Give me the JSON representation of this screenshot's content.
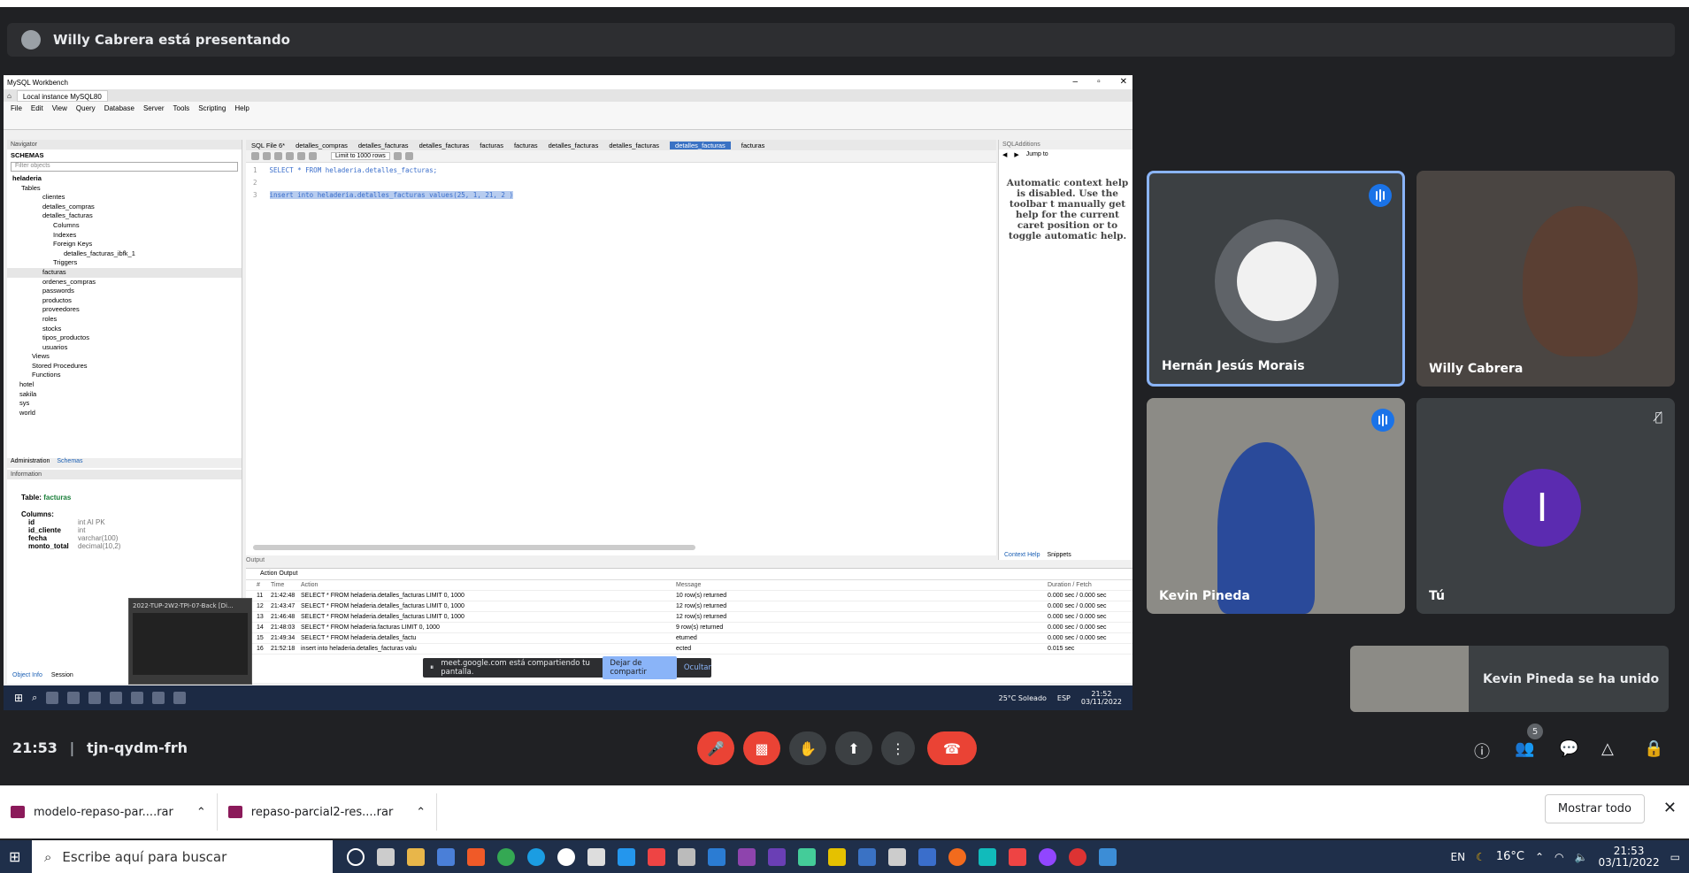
{
  "presenting": {
    "text": "Willy Cabrera está presentando"
  },
  "workbench": {
    "title": "MySQL Workbench",
    "conn_tab": "Local instance MySQL80",
    "menu": [
      "File",
      "Edit",
      "View",
      "Query",
      "Database",
      "Server",
      "Tools",
      "Scripting",
      "Help"
    ],
    "navigator": "Navigator",
    "schemas_header": "SCHEMAS",
    "filter_placeholder": "Filter objects",
    "tree": [
      "heladeria",
      "Tables",
      "clientes",
      "detalles_compras",
      "detalles_facturas",
      "Columns",
      "Indexes",
      "Foreign Keys",
      "detalles_facturas_ibfk_1",
      "Triggers",
      "facturas",
      "ordenes_compras",
      "passwords",
      "productos",
      "proveedores",
      "roles",
      "stocks",
      "tipos_productos",
      "usuarios",
      "Views",
      "Stored Procedures",
      "Functions",
      "hotel",
      "sakila",
      "sys",
      "world"
    ],
    "nav_tabs": [
      "Administration",
      "Schemas"
    ],
    "info_header": "Information",
    "info_table_label": "Table:",
    "info_table": "facturas",
    "info_columns": "Columns:",
    "columns": [
      {
        "name": "id",
        "type": "int AI PK"
      },
      {
        "name": "id_cliente",
        "type": "int"
      },
      {
        "name": "fecha",
        "type": "varchar(100)"
      },
      {
        "name": "monto_total",
        "type": "decimal(10,2)"
      }
    ],
    "bottom_tabs": [
      "Object Info",
      "Session"
    ],
    "editor_tabs": [
      "SQL File 6*",
      "detalles_compras",
      "detalles_facturas",
      "detalles_facturas",
      "facturas",
      "facturas",
      "detalles_facturas",
      "detalles_facturas",
      "detalles_facturas",
      "facturas"
    ],
    "limit": "Limit to 1000 rows",
    "code": [
      {
        "n": "1",
        "text": "SELECT * FROM heladeria.detalles_facturas;"
      },
      {
        "n": "2",
        "text": ""
      },
      {
        "n": "3",
        "text": "insert into heladeria.detalles_facturas values(25, 1, 21, 2 )"
      }
    ],
    "sql_additions": "SQLAdditions",
    "jump_to": "Jump to",
    "context_help": "Automatic context help is disabled. Use the toolbar t manually get help for the current caret position or to toggle automatic help.",
    "ctx_tabs": [
      "Context Help",
      "Snippets"
    ],
    "output_label": "Output",
    "action_output": "Action Output",
    "out_headers": [
      "#",
      "Time",
      "Action",
      "Message",
      "Duration / Fetch"
    ],
    "out_rows": [
      {
        "n": "11",
        "t": "21:42:48",
        "a": "SELECT * FROM heladeria.detalles_facturas LIMIT 0, 1000",
        "m": "10 row(s) returned",
        "d": "0.000 sec / 0.000 sec"
      },
      {
        "n": "12",
        "t": "21:43:47",
        "a": "SELECT * FROM heladeria.detalles_facturas LIMIT 0, 1000",
        "m": "12 row(s) returned",
        "d": "0.000 sec / 0.000 sec"
      },
      {
        "n": "13",
        "t": "21:46:48",
        "a": "SELECT * FROM heladeria.detalles_facturas LIMIT 0, 1000",
        "m": "12 row(s) returned",
        "d": "0.000 sec / 0.000 sec"
      },
      {
        "n": "14",
        "t": "21:48:03",
        "a": "SELECT * FROM heladeria.facturas LIMIT 0, 1000",
        "m": "9 row(s) returned",
        "d": "0.000 sec / 0.000 sec"
      },
      {
        "n": "15",
        "t": "21:49:34",
        "a": "SELECT * FROM heladeria.detalles_factu",
        "m": "eturned",
        "d": "0.000 sec / 0.000 sec"
      },
      {
        "n": "16",
        "t": "21:52:18",
        "a": "insert into heladeria.detalles_facturas valu",
        "m": "ected",
        "d": "0.015 sec"
      }
    ],
    "share_banner": "meet.google.com está compartiendo tu pantalla.",
    "stop_share": "Dejar de compartir",
    "hide": "Ocultar",
    "thumb_title": "2022-TUP-2W2-TPI-07-Back [Di...",
    "weather": "25°C Soleado",
    "lang": "ESP",
    "time": "21:52",
    "date": "03/11/2022"
  },
  "tiles": [
    {
      "name": "Hernán Jesús Morais"
    },
    {
      "name": "Willy Cabrera"
    },
    {
      "name": "Kevin Pineda"
    },
    {
      "name": "Tú",
      "initial": "I"
    }
  ],
  "join_toast": "Kevin Pineda se ha unido",
  "meeting": {
    "time": "21:53",
    "code": "tjn-qydm-frh",
    "participants": "5"
  },
  "downloads": [
    {
      "name": "modelo-repaso-par....rar"
    },
    {
      "name": "repaso-parcial2-res....rar"
    }
  ],
  "show_all": "Mostrar todo",
  "taskbar": {
    "search": "Escribe aquí para buscar",
    "lang": "EN",
    "temp": "16°C",
    "time": "21:53",
    "date": "03/11/2022"
  }
}
